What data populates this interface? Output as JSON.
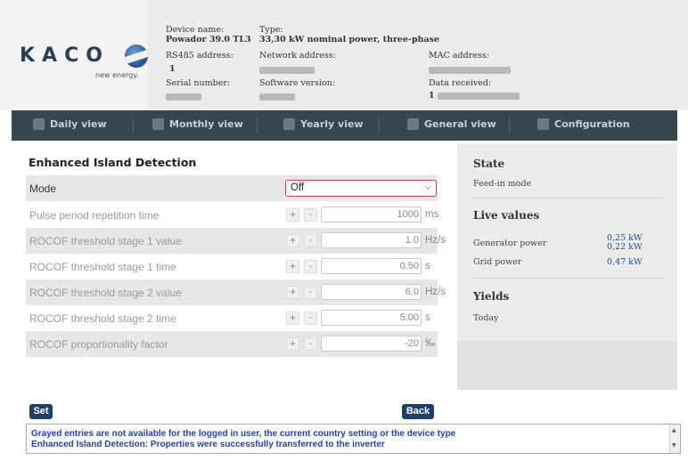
{
  "brand": {
    "logo_text": "KACO",
    "tagline": "new energy."
  },
  "device": {
    "name_label": "Device name:",
    "name_value": "Powador 39.0 TL3",
    "type_label": "Type:",
    "type_value": "33,30 kW nominal power, three-phase",
    "rs485_label": "RS485 address:",
    "rs485_value": "1",
    "network_label": "Network address:",
    "mac_label": "MAC address:",
    "serial_label": "Serial number:",
    "software_label": "Software version:",
    "data_label": "Data received:",
    "data_value": "1"
  },
  "nav": {
    "items": [
      {
        "label": "Daily view",
        "icon": "calendar-day-icon"
      },
      {
        "label": "Monthly view",
        "icon": "calendar-month-icon"
      },
      {
        "label": "Yearly view",
        "icon": "calendar-year-icon"
      },
      {
        "label": "General view",
        "icon": "overview-icon"
      },
      {
        "label": "Configuration",
        "icon": "configuration-icon"
      }
    ]
  },
  "main": {
    "title": "Enhanced Island Detection",
    "mode": {
      "label": "Mode",
      "value": "Off"
    },
    "rows": [
      {
        "label": "Pulse period repetition time",
        "plus": "+",
        "minus": "-",
        "value": "1000",
        "unit": "ms"
      },
      {
        "label": "ROCOF threshold stage 1 value",
        "plus": "+",
        "minus": "-",
        "value": "1.0",
        "unit": "Hz/s"
      },
      {
        "label": "ROCOF threshold stage 1 time",
        "plus": "+",
        "minus": "-",
        "value": "0.50",
        "unit": "s"
      },
      {
        "label": "ROCOF threshold stage 2 value",
        "plus": "+",
        "minus": "-",
        "value": "6.0",
        "unit": "Hz/s"
      },
      {
        "label": "ROCOF threshold stage 2 time",
        "plus": "+",
        "minus": "-",
        "value": "5.00",
        "unit": "s"
      },
      {
        "label": "ROCOF proportionality factor",
        "plus": "+",
        "minus": "-",
        "value": "-20",
        "unit": "‰"
      }
    ],
    "set_label": "Set",
    "back_label": "Back"
  },
  "sidebar": {
    "state_title": "State",
    "state_value": "Feed-in mode",
    "live_title": "Live values",
    "generator_label": "Generator power",
    "generator_value_1": "0,25 kW",
    "generator_value_2": "0,22 kW",
    "grid_label": "Grid power",
    "grid_value": "0,47 kW",
    "yields_title": "Yields",
    "today_label": "Today"
  },
  "messages": [
    "Grayed entries are not available for the logged in user, the current country setting or the device type",
    "Enhanced Island Detection: Properties were successfully transferred to the inverter"
  ],
  "colors": {
    "nav_bg": "#37474f",
    "button_bg": "#1f3f6b",
    "message_text": "#1f3fb5",
    "select_border": "#b8485a"
  }
}
